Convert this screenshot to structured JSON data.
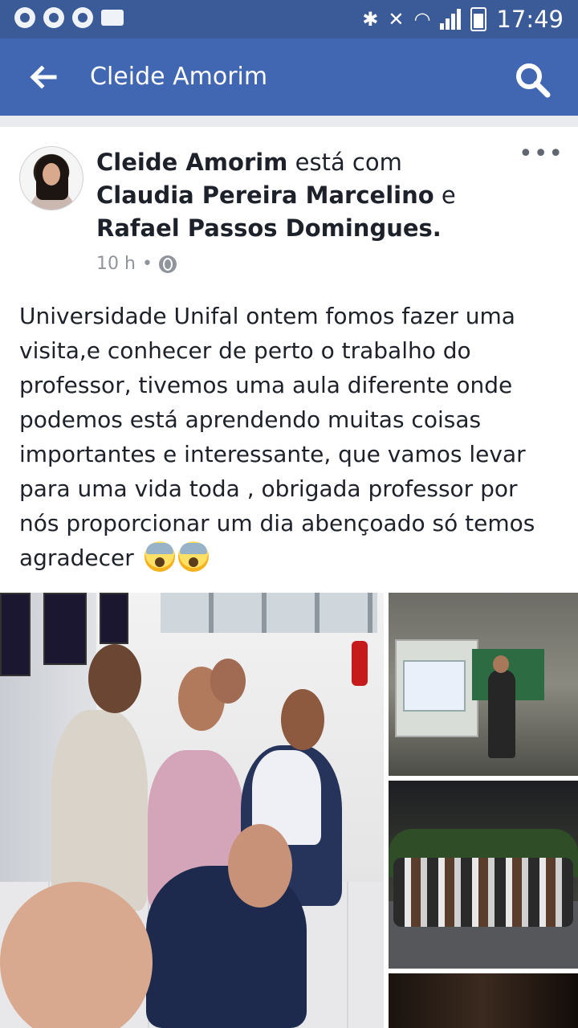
{
  "status_bar": {
    "time": "17:49",
    "left_icons": [
      "chrome-icon",
      "sync-icon",
      "facebook-notification-icon",
      "mail-icon"
    ],
    "right_icons": [
      "bluetooth-icon",
      "mute-icon",
      "wifi-icon",
      "cell-signal-icon",
      "battery-icon"
    ]
  },
  "app_bar": {
    "title": "Cleide Amorim",
    "back_icon": "arrow-left-icon",
    "search_icon": "search-icon"
  },
  "post": {
    "author": "Cleide Amorim",
    "with_text": " está com ",
    "tagged_1": "Claudia Pereira Marcelino",
    "and_text": " e ",
    "tagged_2": "Rafael Passos Domingues",
    "end_punct": ".",
    "time": "10 h",
    "separator": "•",
    "privacy_icon": "globe-icon",
    "more_icon": "more-horizontal-icon",
    "body": "Universidade Unifal ontem fomos fazer uma visita,e conhecer de perto o trabalho do professor, tivemos uma aula diferente onde podemos está aprendendo muitas coisas importantes e interessante, que vamos levar para uma vida toda , obrigada professor por nós proporcionar um dia abençoado só temos agradecer",
    "emoji": [
      "screaming-face-emoji",
      "screaming-face-emoji"
    ]
  },
  "photos": {
    "count": 4,
    "descriptions": [
      "group-selfie-hallway",
      "classroom-presentation",
      "group-outdoor-night",
      "dark-photo"
    ]
  },
  "colors": {
    "status_bar": "#3a5a98",
    "app_bar": "#4267b2",
    "text": "#1d2129",
    "meta": "#90949c"
  }
}
